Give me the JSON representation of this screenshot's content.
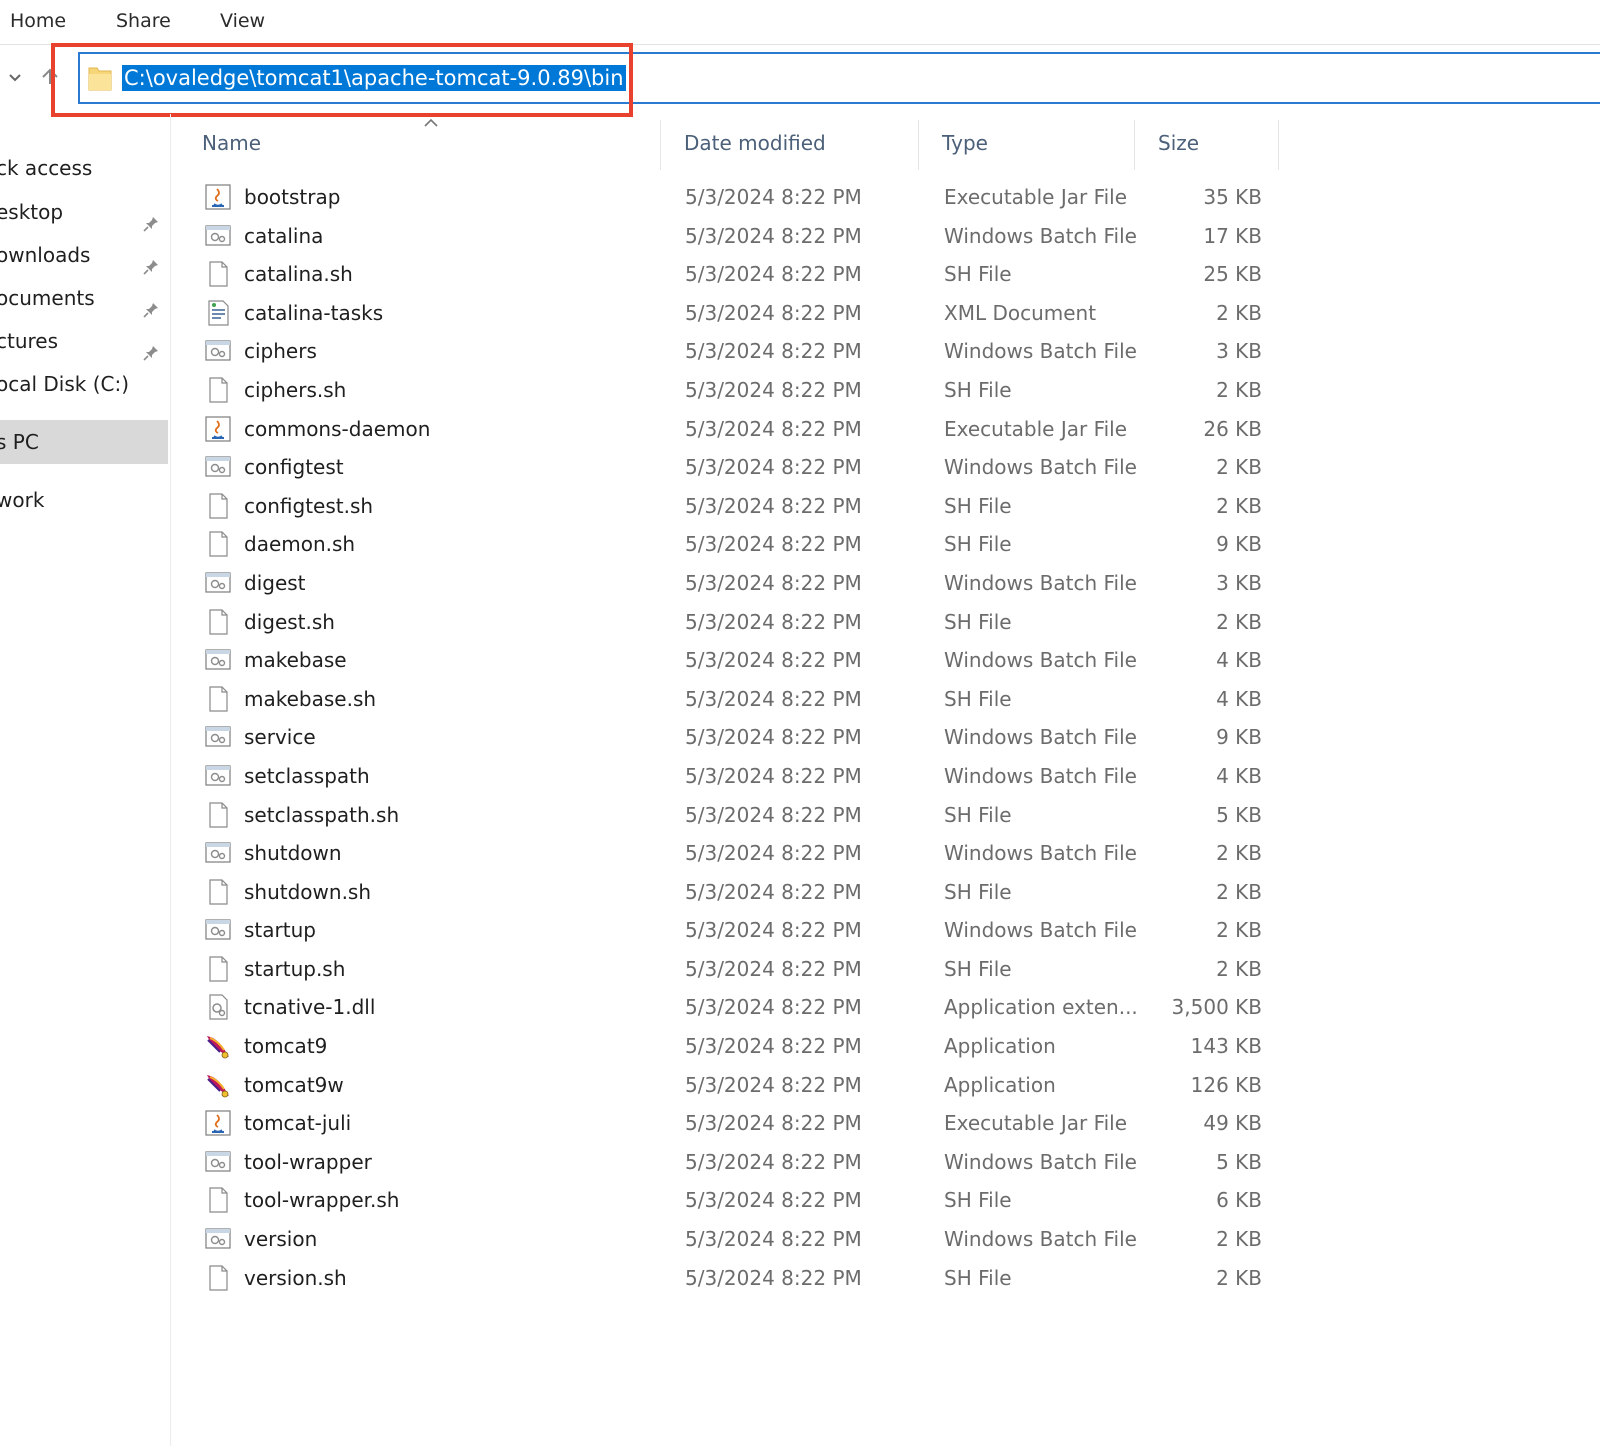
{
  "ribbon": {
    "tabs": [
      "Home",
      "Share",
      "View"
    ]
  },
  "address": {
    "path": "C:\\ovaledge\\tomcat1\\apache-tomcat-9.0.89\\bin"
  },
  "sidebar": {
    "items": [
      {
        "label": "ck access",
        "pinned": false
      },
      {
        "label": "esktop",
        "pinned": true
      },
      {
        "label": "ownloads",
        "pinned": true
      },
      {
        "label": "ocuments",
        "pinned": true
      },
      {
        "label": "ctures",
        "pinned": true
      },
      {
        "label": "ocal Disk (C:)",
        "pinned": false
      },
      {
        "label": "s PC",
        "pinned": false,
        "selected": true
      },
      {
        "label": "work",
        "pinned": false
      }
    ]
  },
  "columns": {
    "name": "Name",
    "date": "Date modified",
    "type": "Type",
    "size": "Size"
  },
  "files": [
    {
      "name": "bootstrap",
      "date": "5/3/2024 8:22 PM",
      "type": "Executable Jar File",
      "size": "35 KB",
      "icon": "jar-icon"
    },
    {
      "name": "catalina",
      "date": "5/3/2024 8:22 PM",
      "type": "Windows Batch File",
      "size": "17 KB",
      "icon": "batch-file-icon"
    },
    {
      "name": "catalina.sh",
      "date": "5/3/2024 8:22 PM",
      "type": "SH File",
      "size": "25 KB",
      "icon": "file-icon"
    },
    {
      "name": "catalina-tasks",
      "date": "5/3/2024 8:22 PM",
      "type": "XML Document",
      "size": "2 KB",
      "icon": "xml-file-icon"
    },
    {
      "name": "ciphers",
      "date": "5/3/2024 8:22 PM",
      "type": "Windows Batch File",
      "size": "3 KB",
      "icon": "batch-file-icon"
    },
    {
      "name": "ciphers.sh",
      "date": "5/3/2024 8:22 PM",
      "type": "SH File",
      "size": "2 KB",
      "icon": "file-icon"
    },
    {
      "name": "commons-daemon",
      "date": "5/3/2024 8:22 PM",
      "type": "Executable Jar File",
      "size": "26 KB",
      "icon": "jar-icon"
    },
    {
      "name": "configtest",
      "date": "5/3/2024 8:22 PM",
      "type": "Windows Batch File",
      "size": "2 KB",
      "icon": "batch-file-icon"
    },
    {
      "name": "configtest.sh",
      "date": "5/3/2024 8:22 PM",
      "type": "SH File",
      "size": "2 KB",
      "icon": "file-icon"
    },
    {
      "name": "daemon.sh",
      "date": "5/3/2024 8:22 PM",
      "type": "SH File",
      "size": "9 KB",
      "icon": "file-icon"
    },
    {
      "name": "digest",
      "date": "5/3/2024 8:22 PM",
      "type": "Windows Batch File",
      "size": "3 KB",
      "icon": "batch-file-icon"
    },
    {
      "name": "digest.sh",
      "date": "5/3/2024 8:22 PM",
      "type": "SH File",
      "size": "2 KB",
      "icon": "file-icon"
    },
    {
      "name": "makebase",
      "date": "5/3/2024 8:22 PM",
      "type": "Windows Batch File",
      "size": "4 KB",
      "icon": "batch-file-icon"
    },
    {
      "name": "makebase.sh",
      "date": "5/3/2024 8:22 PM",
      "type": "SH File",
      "size": "4 KB",
      "icon": "file-icon"
    },
    {
      "name": "service",
      "date": "5/3/2024 8:22 PM",
      "type": "Windows Batch File",
      "size": "9 KB",
      "icon": "batch-file-icon"
    },
    {
      "name": "setclasspath",
      "date": "5/3/2024 8:22 PM",
      "type": "Windows Batch File",
      "size": "4 KB",
      "icon": "batch-file-icon"
    },
    {
      "name": "setclasspath.sh",
      "date": "5/3/2024 8:22 PM",
      "type": "SH File",
      "size": "5 KB",
      "icon": "file-icon"
    },
    {
      "name": "shutdown",
      "date": "5/3/2024 8:22 PM",
      "type": "Windows Batch File",
      "size": "2 KB",
      "icon": "batch-file-icon"
    },
    {
      "name": "shutdown.sh",
      "date": "5/3/2024 8:22 PM",
      "type": "SH File",
      "size": "2 KB",
      "icon": "file-icon"
    },
    {
      "name": "startup",
      "date": "5/3/2024 8:22 PM",
      "type": "Windows Batch File",
      "size": "2 KB",
      "icon": "batch-file-icon"
    },
    {
      "name": "startup.sh",
      "date": "5/3/2024 8:22 PM",
      "type": "SH File",
      "size": "2 KB",
      "icon": "file-icon"
    },
    {
      "name": "tcnative-1.dll",
      "date": "5/3/2024 8:22 PM",
      "type": "Application exten...",
      "size": "3,500 KB",
      "icon": "dll-file-icon"
    },
    {
      "name": "tomcat9",
      "date": "5/3/2024 8:22 PM",
      "type": "Application",
      "size": "143 KB",
      "icon": "tomcat-feather-icon"
    },
    {
      "name": "tomcat9w",
      "date": "5/3/2024 8:22 PM",
      "type": "Application",
      "size": "126 KB",
      "icon": "tomcat-feather-icon"
    },
    {
      "name": "tomcat-juli",
      "date": "5/3/2024 8:22 PM",
      "type": "Executable Jar File",
      "size": "49 KB",
      "icon": "jar-icon"
    },
    {
      "name": "tool-wrapper",
      "date": "5/3/2024 8:22 PM",
      "type": "Windows Batch File",
      "size": "5 KB",
      "icon": "batch-file-icon"
    },
    {
      "name": "tool-wrapper.sh",
      "date": "5/3/2024 8:22 PM",
      "type": "SH File",
      "size": "6 KB",
      "icon": "file-icon"
    },
    {
      "name": "version",
      "date": "5/3/2024 8:22 PM",
      "type": "Windows Batch File",
      "size": "2 KB",
      "icon": "batch-file-icon"
    },
    {
      "name": "version.sh",
      "date": "5/3/2024 8:22 PM",
      "type": "SH File",
      "size": "2 KB",
      "icon": "file-icon"
    }
  ],
  "colors": {
    "accent": "#0078d7",
    "highlight_border": "#e8412e",
    "selected_bg": "#d9d9d9"
  }
}
